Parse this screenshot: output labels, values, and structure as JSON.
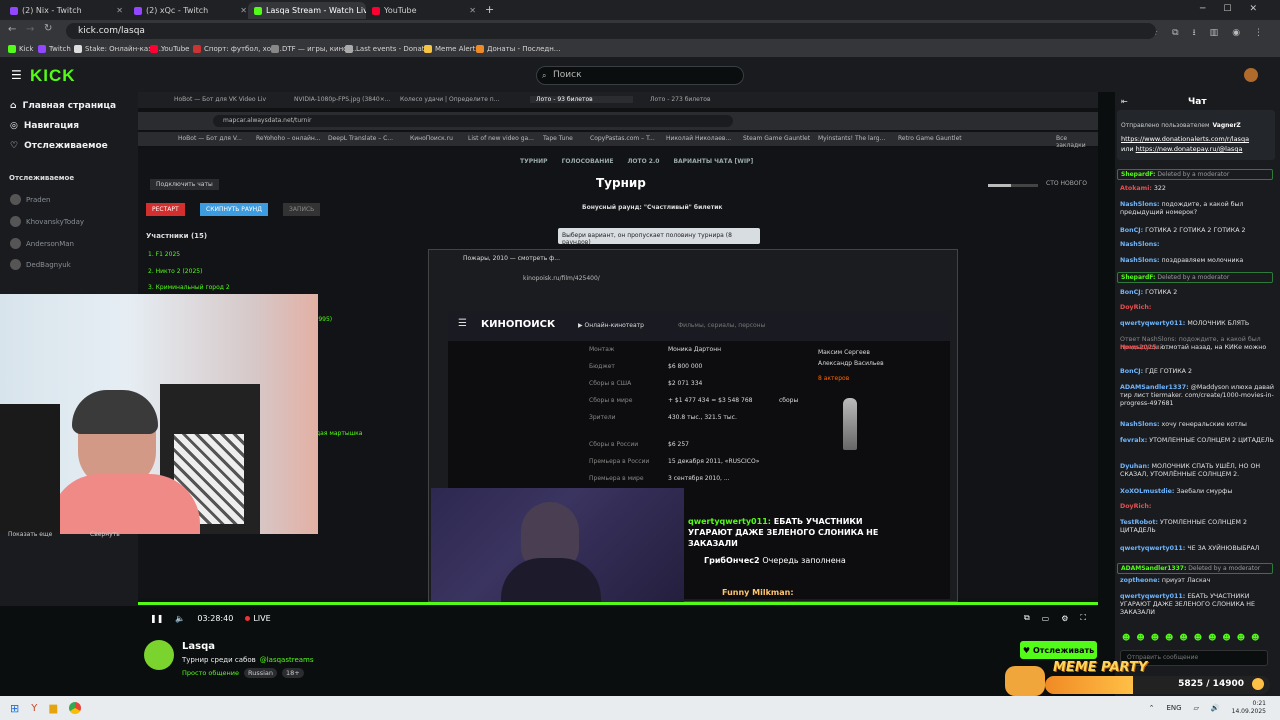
{
  "browser": {
    "tabs": [
      {
        "label": "(2) Nix - Twitch",
        "color": "#9146ff"
      },
      {
        "label": "(2) xQc - Twitch",
        "color": "#9146ff"
      },
      {
        "label": "Lasqa Stream - Watch Live",
        "color": "#53fc18"
      },
      {
        "label": "YouTube",
        "color": "#ff0033"
      }
    ],
    "url": "kick.com/lasqa",
    "bookmarks": [
      "Kick",
      "Twitch",
      "Stake: Онлайн-кази...",
      "YouTube",
      "Спорт: футбол, хок...",
      "DTF — игры, кино,...",
      "Last events - Donat...",
      "Meme Alerts",
      "Донаты - Последн..."
    ]
  },
  "kick": {
    "logo": "KICK",
    "search_placeholder": "Поиск",
    "nav": [
      "Главная страница",
      "Навигация",
      "Отслеживаемое"
    ],
    "following_header": "Отслеживаемое",
    "following": [
      "Praden",
      "KhovanskyToday",
      "AndersonMan",
      "DedBagnyuk"
    ]
  },
  "stream": {
    "inner_tabs": [
      "HoBot — Бот для VK Video Liv",
      "NVIDIA-1080p-FPS.jpg (3840×...",
      "Колесо удачи | Определите п...",
      "Лото - 93 билетов",
      "Лото - 273 билетов"
    ],
    "inner_url": "mapcar.alwaysdata.net/turnir",
    "inner_bookmarks": [
      "HoBot — Бот для V...",
      "ReYohoho – онлайн...",
      "DeepL Translate – С...",
      "КиноПоиск.ru",
      "List of new video ga...",
      "Tape Tune",
      "CopyPastas.com – T...",
      "Николай Николаев...",
      "Steam Game Gauntlet",
      "Myinstants! The larg...",
      "Retro Game Gauntlet",
      "Все закладки"
    ],
    "page_nav": [
      "ТУРНИР",
      "ГОЛОСОВАНИЕ",
      "ЛОТО 2.0",
      "ВАРИАНТЫ ЧАТА [WIP]"
    ],
    "connect_chat": "Подключить чаты",
    "page_title": "Турнир",
    "restart_btn": "РЕСТАРТ",
    "skip_btn": "СКИПНУТЬ РАУНД",
    "record_btn": "ЗАПИСЬ",
    "participants": "Участники (15)",
    "participant_list": [
      "1. F1 2025",
      "2. Никто 2 (2025)",
      "3. Криминальный город 2"
    ],
    "bonus_round": "Бонусный раунд: \"Счастливый\" билетик",
    "choose_variant": "Выбери вариант, он пропускает половину турнира (8 раундов)",
    "hidden_year": "(995)",
    "hidden_item": "дая мартышка",
    "newest": "СТО НОВОГО",
    "kp": {
      "tab": "Пожары, 2010 — смотреть ф...",
      "url": "kinopoisk.ru/film/425400/",
      "logo": "КИНОПОИСК",
      "online": "Онлайн-кинотеатр",
      "search": "Фильмы, сериалы, персоны",
      "rows": [
        {
          "label": "Монтаж",
          "value": "Моника Дартонн"
        },
        {
          "label": "Бюджет",
          "value": "$6 800 000"
        },
        {
          "label": "Сборы в США",
          "value": "$2 071 334"
        },
        {
          "label": "Сборы в мире",
          "value": "+ $1 477 434 = $3 548 768"
        },
        {
          "label": "Зрители",
          "value": "430.8 тыс., 321.5 тыс."
        },
        {
          "label": "Сборы в России",
          "value": "$6 257"
        },
        {
          "label": "Премьера в России",
          "value": "15 декабря 2011, «RUSCICO»"
        },
        {
          "label": "Премьера в мире",
          "value": "3 сентября 2010, ..."
        }
      ],
      "actors": [
        "Максим Сергеев",
        "Александр Васильев"
      ],
      "actors_more": "8 актеров",
      "fees": "сборы"
    },
    "overlay_chat": [
      {
        "user": "qwertyqwerty011:",
        "text": "ЕБАТЬ УЧАСТНИКИ УГАРАЮТ ДАЖЕ ЗЕЛЕНОГО СЛОНИКА НЕ ЗАКАЗАЛИ"
      },
      {
        "user": "ГрибОнчес2",
        "text": "Очередь заполнена"
      },
      {
        "user": "Funny Milkman:",
        "text": ""
      }
    ],
    "cam_show_more": "Показать еще",
    "cam_collapse": "Свернуть",
    "time": "03:28:40",
    "live": "LIVE"
  },
  "channel": {
    "name": "Lasqa",
    "title": "Турнир среди сабов",
    "mention": "@lasqastreams",
    "category": "Просто общение",
    "tags": [
      "Russian",
      "18+"
    ],
    "follow_btn": "Отслеживать"
  },
  "chat": {
    "title": "Чат",
    "pinned_top": "Отправлено пользователем",
    "pinned_user": "VagnerZ",
    "pinned_links": "https://www.donationalerts.com/r/lasqa",
    "pinned_or": "или",
    "pinned_link2": "https://new.donatepay.ru/@lasqa",
    "messages": [
      {
        "type": "mod",
        "user": "ShepardF:",
        "text": "Deleted by a moderator"
      },
      {
        "type": "msg",
        "user": "Atokami:",
        "text": "322",
        "color": "#e84f4f"
      },
      {
        "type": "msg",
        "user": "NashSlons:",
        "text": "подождите, а какой был предыдущий номерок?",
        "color": "#6fb6ff"
      },
      {
        "type": "msg",
        "user": "BonCJ:",
        "text": "ГОТИКА 2 ГОТИКА 2 ГОТИКА 2",
        "color": "#6fb6ff"
      },
      {
        "type": "msg",
        "user": "NashSlons:",
        "text": "",
        "color": "#6fb6ff"
      },
      {
        "type": "msg",
        "user": "NashSlons:",
        "text": "поздравляем молочника",
        "color": "#6fb6ff"
      },
      {
        "type": "mod",
        "user": "ShepardF:",
        "text": "Deleted by a moderator"
      },
      {
        "type": "msg",
        "user": "BonCJ:",
        "text": "ГОТИКА 2",
        "color": "#6fb6ff"
      },
      {
        "type": "msg",
        "user": "DoyRich:",
        "text": "",
        "color": "#e84f4f"
      },
      {
        "type": "msg",
        "user": "qwertyqwerty011:",
        "text": "МОЛОЧНИК БЛЯТЬ",
        "color": "#6fb6ff"
      },
      {
        "type": "reply",
        "user": "",
        "text": "Ответ NashSlons: подождите, а какой был предыдущий..."
      },
      {
        "type": "msg",
        "user": "Hows2025:",
        "text": "отмотай назад, на КИКе можно",
        "color": "#e84f4f"
      },
      {
        "type": "msg",
        "user": "BonCJ:",
        "text": "ГДЕ ГОТИКА 2",
        "color": "#6fb6ff"
      },
      {
        "type": "msg",
        "user": "ADAMSandler1337:",
        "text": "@Maddyson илюха давай тир лист tiermaker. com/create/1000-movies-in-progress-497681",
        "color": "#6fb6ff"
      },
      {
        "type": "msg",
        "user": "NashSlons:",
        "text": "хочу генеральские котлы",
        "color": "#6fb6ff"
      },
      {
        "type": "msg",
        "user": "fevralx:",
        "text": "УТОМЛЕННЫЕ СОЛНЦЕМ 2 ЦИТАДЕЛЬ",
        "color": "#6fb6ff"
      },
      {
        "type": "msg",
        "user": "Dyuhan:",
        "text": "МОЛОЧНИК СПАТЬ УШЁЛ, НО ОН СКАЗАЛ, УТОМЛЁННЫЕ СОЛНЦЕМ 2.",
        "color": "#6fb6ff"
      },
      {
        "type": "msg",
        "user": "XoXOLmustdie:",
        "text": "Заебали смурфы",
        "color": "#6fb6ff"
      },
      {
        "type": "msg",
        "user": "DoyRich:",
        "text": "",
        "color": "#e84f4f"
      },
      {
        "type": "msg",
        "user": "TestRobot:",
        "text": "УТОМЛЕННЫЕ СОЛНЦЕМ 2 ЦИТАДЕЛЬ",
        "color": "#6fb6ff"
      },
      {
        "type": "msg",
        "user": "qwertyqwerty011:",
        "text": "ЧЕ ЗА ХУЙНЮВЫБРАЛ",
        "color": "#6fb6ff"
      },
      {
        "type": "mod",
        "user": "ADAMSandler1337:",
        "text": "Deleted by a moderator"
      },
      {
        "type": "msg",
        "user": "zoptheone:",
        "text": "приуэт Ласкач",
        "color": "#6fb6ff"
      },
      {
        "type": "msg",
        "user": "qwertyqwerty011:",
        "text": "ЕБАТЬ УЧАСТНИКИ УГАРАЮТ ДАЖЕ ЗЕЛЕНОГО СЛОНИКА НЕ ЗАКАЗАЛИ",
        "color": "#6fb6ff"
      }
    ],
    "input_placeholder": "Отправить сообщение"
  },
  "alert": {
    "label": "MEME PARTY",
    "progress": "5825 / 14900"
  },
  "taskbar": {
    "lang": "ENG",
    "time": "0:21",
    "date": "14.09.2025"
  },
  "colors": {
    "kick_green": "#53fc18",
    "bg": "#0b0e0f",
    "panel": "#191b1f"
  }
}
